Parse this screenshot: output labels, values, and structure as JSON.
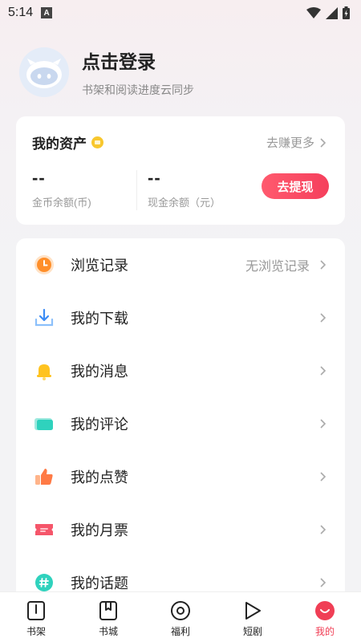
{
  "status_bar": {
    "time": "5:14",
    "notification_letter": "A"
  },
  "profile": {
    "title": "点击登录",
    "subtitle": "书架和阅读进度云同步"
  },
  "assets": {
    "title": "我的资产",
    "earn_more": "去赚更多",
    "coins_value": "--",
    "coins_label": "金币余额(币)",
    "cash_value": "--",
    "cash_label": "现金余额（元）",
    "withdraw_label": "去提现"
  },
  "menu": {
    "items": [
      {
        "label": "浏览记录",
        "extra": "无浏览记录",
        "icon": "clock-icon"
      },
      {
        "label": "我的下载",
        "icon": "download-icon"
      },
      {
        "label": "我的消息",
        "icon": "bell-icon"
      },
      {
        "label": "我的评论",
        "icon": "comment-icon"
      },
      {
        "label": "我的点赞",
        "icon": "thumbs-up-icon"
      },
      {
        "label": "我的月票",
        "icon": "ticket-icon"
      },
      {
        "label": "我的话题",
        "icon": "hashtag-icon"
      }
    ]
  },
  "nav": {
    "items": [
      {
        "label": "书架",
        "icon": "bookshelf-icon"
      },
      {
        "label": "书城",
        "icon": "bookstore-icon"
      },
      {
        "label": "福利",
        "icon": "welfare-icon"
      },
      {
        "label": "短剧",
        "icon": "play-icon"
      },
      {
        "label": "我的",
        "icon": "profile-icon",
        "active": true
      }
    ]
  },
  "colors": {
    "accent": "#f03e55",
    "coin": "#f8c72e",
    "clock": "#ff8f2a",
    "download": "#3c8cf5"
  }
}
